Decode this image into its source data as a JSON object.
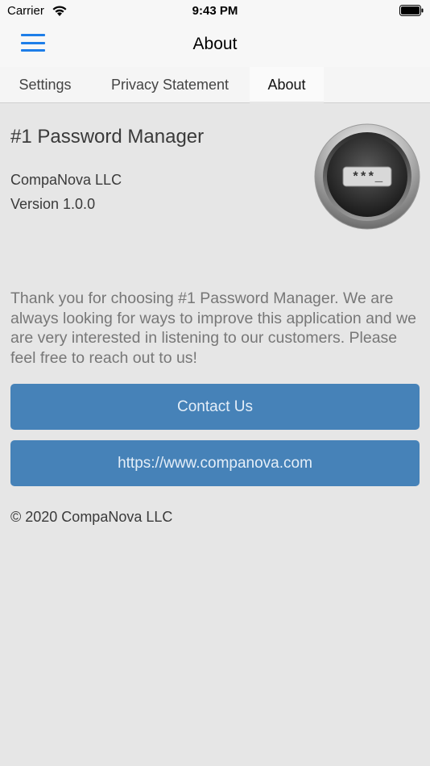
{
  "status_bar": {
    "carrier": "Carrier",
    "time": "9:43 PM",
    "wifi_icon": "wifi-icon",
    "battery_icon": "battery-icon"
  },
  "nav": {
    "title": "About",
    "menu_icon": "hamburger-menu-icon",
    "accent_color": "#1e7ee8"
  },
  "tabs": [
    {
      "label": "Settings",
      "active": false
    },
    {
      "label": "Privacy Statement",
      "active": false
    },
    {
      "label": "About",
      "active": true
    }
  ],
  "about": {
    "app_name": "#1 Password Manager",
    "company": "CompaNova LLC",
    "version": "Version 1.0.0",
    "logo_icon": "password-lock-icon",
    "logo_text": "***_",
    "description": "Thank you for choosing #1 Password Manager. We are always looking for ways to improve this application and we are very interested in listening to our customers. Please feel free to reach out to us!",
    "contact_label": "Contact Us",
    "url_label": "https://www.companova.com",
    "copyright": "© 2020 CompaNova LLC",
    "button_color": "#4682b8"
  }
}
